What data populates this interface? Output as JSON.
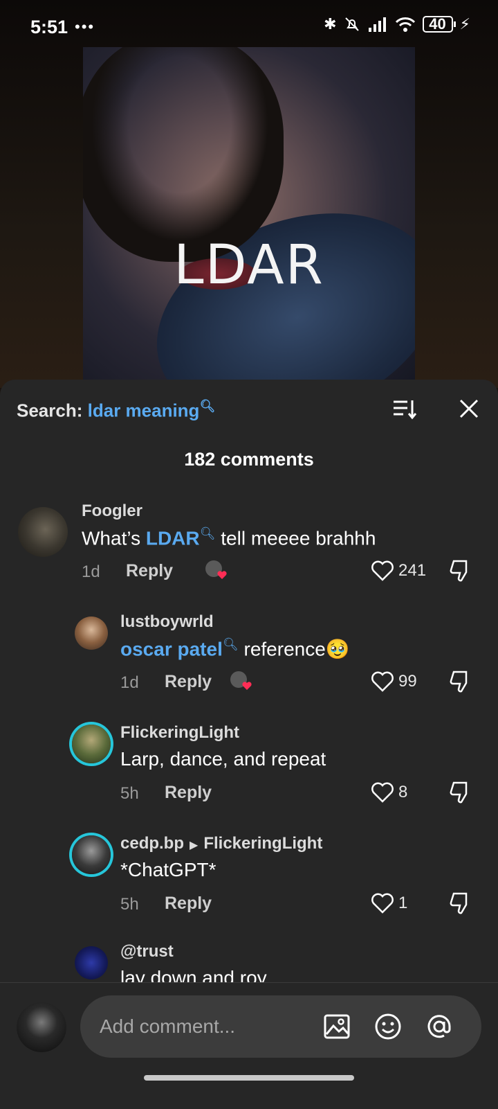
{
  "status_bar": {
    "time": "5:51",
    "app_icons": "•••",
    "battery": "40"
  },
  "video": {
    "overlay_text": "LDAR"
  },
  "comments_panel": {
    "search_label": "Search:",
    "search_term": "ldar meaning",
    "count_label": "182 comments",
    "comments": [
      {
        "author": "Foogler",
        "text_prefix": "What’s ",
        "mention": "LDAR",
        "text_suffix": " tell meeee brahhh",
        "time": "1d",
        "reply_label": "Reply",
        "likes": "241"
      },
      {
        "author": "lustboywrld",
        "text_prefix": "",
        "mention": "oscar patel",
        "text_suffix": " reference🥹",
        "time": "1d",
        "reply_label": "Reply",
        "likes": "99"
      },
      {
        "author": "FlickeringLight",
        "text": "Larp, dance, and repeat",
        "time": "5h",
        "reply_label": "Reply",
        "likes": "8"
      },
      {
        "author": "cedp.bp",
        "reply_to": "FlickeringLight",
        "text": "*ChatGPT*",
        "time": "5h",
        "reply_label": "Reply",
        "likes": "1"
      },
      {
        "author": "@trust",
        "text": "lay down and roy"
      }
    ]
  },
  "input_bar": {
    "placeholder": "Add comment..."
  },
  "colors": {
    "accent_link": "#5aaaf0",
    "panel_bg": "#262626",
    "ring": "#26c6da"
  }
}
